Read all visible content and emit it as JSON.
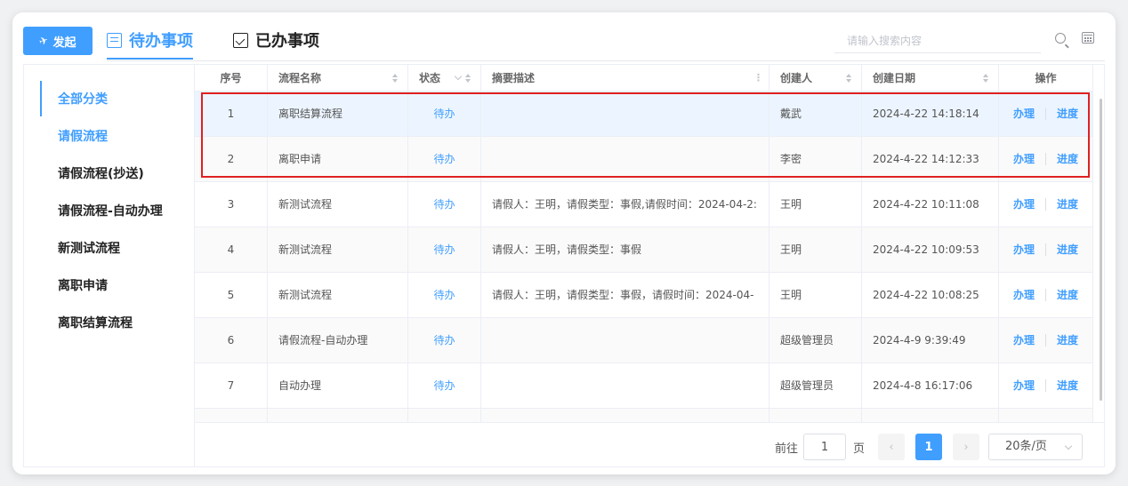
{
  "header": {
    "launch_label": "发起",
    "tabs": [
      {
        "label": "待办事项",
        "active": true
      },
      {
        "label": "已办事项",
        "active": false
      }
    ],
    "search_placeholder": "请输入搜索内容",
    "accent_color": "#409eff"
  },
  "sidebar": {
    "items": [
      {
        "label": "全部分类",
        "selected": true
      },
      {
        "label": "请假流程"
      },
      {
        "label": "请假流程(抄送)"
      },
      {
        "label": "请假流程-自动办理"
      },
      {
        "label": "新测试流程"
      },
      {
        "label": "离职申请"
      },
      {
        "label": "离职结算流程"
      }
    ]
  },
  "table": {
    "columns": [
      "序号",
      "流程名称",
      "状态",
      "摘要描述",
      "创建人",
      "创建日期",
      "操作"
    ],
    "rows": [
      {
        "no": "1",
        "name": "离职结算流程",
        "status": "待办",
        "summary": "",
        "creator": "戴武",
        "date": "2024-4-22 14:18:14"
      },
      {
        "no": "2",
        "name": "离职申请",
        "status": "待办",
        "summary": "",
        "creator": "李密",
        "date": "2024-4-22 14:12:33"
      },
      {
        "no": "3",
        "name": "新测试流程",
        "status": "待办",
        "summary": "请假人：王明，请假类型：事假,请假时间：2024-04-2:",
        "creator": "王明",
        "date": "2024-4-22 10:11:08"
      },
      {
        "no": "4",
        "name": "新测试流程",
        "status": "待办",
        "summary": "请假人：王明，请假类型：事假",
        "creator": "王明",
        "date": "2024-4-22 10:09:53"
      },
      {
        "no": "5",
        "name": "新测试流程",
        "status": "待办",
        "summary": "请假人：王明，请假类型：事假，请假时间：2024-04-",
        "creator": "王明",
        "date": "2024-4-22 10:08:25"
      },
      {
        "no": "6",
        "name": "请假流程-自动办理",
        "status": "待办",
        "summary": "",
        "creator": "超级管理员",
        "date": "2024-4-9 9:39:49"
      },
      {
        "no": "7",
        "name": "自动办理",
        "status": "待办",
        "summary": "",
        "creator": "超级管理员",
        "date": "2024-4-8 16:17:06"
      }
    ],
    "actions": {
      "handle": "办理",
      "progress": "进度"
    },
    "highlight_color": "#e02020"
  },
  "pagination": {
    "goto_label": "前往",
    "goto_value": "1",
    "page_unit": "页",
    "current_page": "1",
    "page_size": "20条/页",
    "prev_icon": "‹",
    "next_icon": "›"
  }
}
